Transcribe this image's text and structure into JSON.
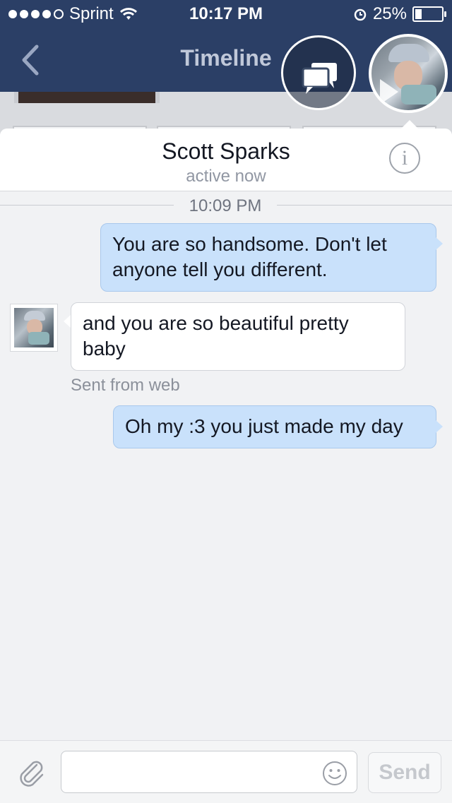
{
  "status_bar": {
    "carrier": "Sprint",
    "time": "10:17 PM",
    "battery": "25%",
    "battery_level": 0.25
  },
  "nav": {
    "back_icon": "chevron-left-icon",
    "title": "Timeline"
  },
  "chat_heads": {
    "messages_icon": "chat-bubbles-icon",
    "avatar_icon": "contact-avatar"
  },
  "conversation": {
    "contact_name": "Scott Sparks",
    "contact_status": "active now",
    "info_icon": "info-icon",
    "info_glyph": "i",
    "timestamp": "10:09 PM",
    "messages": [
      {
        "direction": "out",
        "text": "You are so handsome. Don't let anyone tell you different."
      },
      {
        "direction": "in",
        "text": "and you are so beautiful pretty baby"
      },
      {
        "direction": "out",
        "text": "Oh my :3 you just made my day"
      }
    ],
    "sent_from": "Sent from web"
  },
  "composer": {
    "attach_icon": "paperclip-icon",
    "input_value": "",
    "input_placeholder": "",
    "emoji_icon": "smiley-icon",
    "send_label": "Send"
  },
  "colors": {
    "nav_bg": "#2b3f66",
    "outgoing_bubble": "#c9e1fb",
    "incoming_bubble": "#ffffff",
    "panel_bg": "#f1f2f4"
  }
}
